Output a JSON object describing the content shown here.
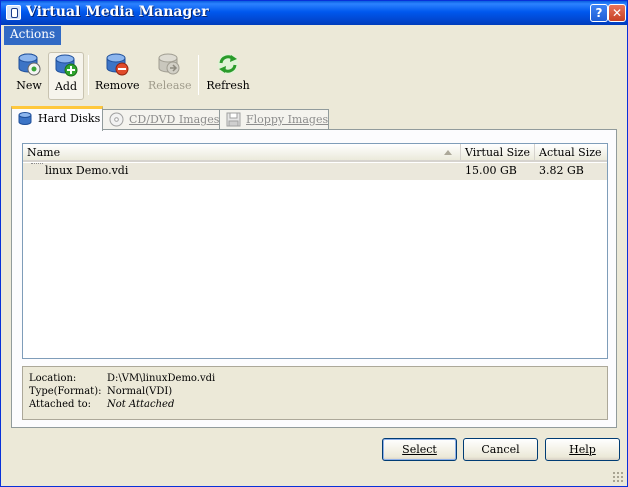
{
  "window": {
    "title": "Virtual Media Manager",
    "help_glyph": "?",
    "close_glyph": "✕"
  },
  "menu": {
    "actions_label": "Actions"
  },
  "toolbar": {
    "new_label": "New",
    "add_label": "Add",
    "remove_label": "Remove",
    "release_label": "Release",
    "refresh_label": "Refresh",
    "add_pressed": true,
    "release_disabled": true
  },
  "tabs": [
    {
      "label": "Hard Disks",
      "icon": "hard-disk-icon",
      "active": true
    },
    {
      "label": "CD/DVD Images",
      "icon": "cd-dvd-icon",
      "active": false
    },
    {
      "label": "Floppy Images",
      "icon": "floppy-icon",
      "active": false
    }
  ],
  "list": {
    "columns": [
      "Name",
      "Virtual Size",
      "Actual Size"
    ],
    "sort_column": "Name",
    "rows": [
      {
        "name": "linux Demo.vdi",
        "virtual_size": "15.00 GB",
        "actual_size": "3.82 GB",
        "selected": true
      }
    ]
  },
  "details": {
    "location_label": "Location:",
    "location_value": "D:\\VM\\linuxDemo.vdi",
    "type_label": "Type(Format):",
    "type_value": "Normal(VDI)",
    "attached_label": "Attached to:",
    "attached_value": "Not Attached"
  },
  "buttons": {
    "select_label": "Select",
    "cancel_label": "Cancel",
    "help_label": "Help"
  },
  "colors": {
    "titlebar": "#0058ee",
    "menu_highlight": "#316ac5",
    "window_bg": "#ece9d8",
    "active_tab_accent": "#ffc83c"
  }
}
